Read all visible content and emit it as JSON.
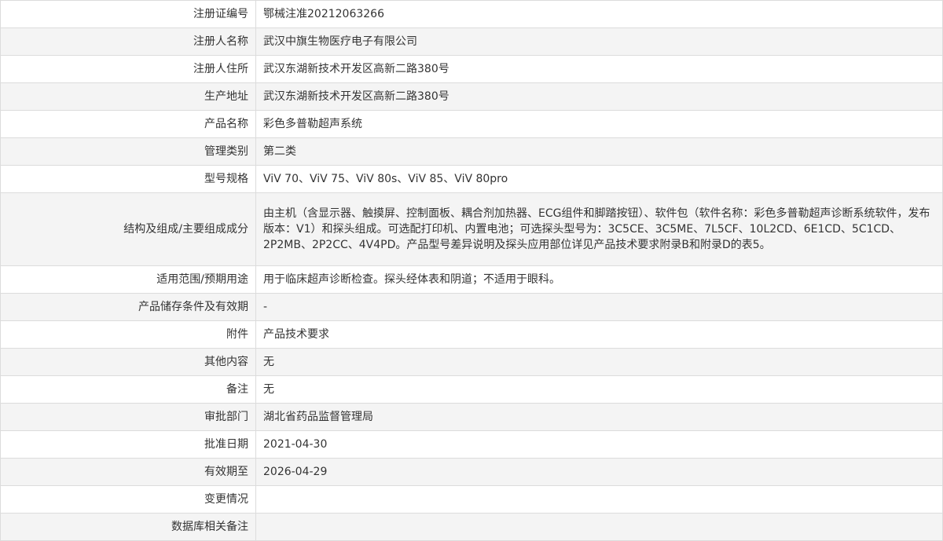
{
  "records": [
    {
      "label": "注册证编号",
      "value": "鄂械注准20212063266"
    },
    {
      "label": "注册人名称",
      "value": "武汉中旗生物医疗电子有限公司"
    },
    {
      "label": "注册人住所",
      "value": "武汉东湖新技术开发区高新二路380号"
    },
    {
      "label": "生产地址",
      "value": "武汉东湖新技术开发区高新二路380号"
    },
    {
      "label": "产品名称",
      "value": "彩色多普勒超声系统"
    },
    {
      "label": "管理类别",
      "value": "第二类"
    },
    {
      "label": "型号规格",
      "value": "ViV 70、ViV 75、ViV 80s、ViV 85、ViV 80pro"
    },
    {
      "label": "结构及组成/主要组成成分",
      "value": "由主机（含显示器、触摸屏、控制面板、耦合剂加热器、ECG组件和脚踏按钮）、软件包（软件名称：彩色多普勒超声诊断系统软件，发布版本：V1）和探头组成。可选配打印机、内置电池；可选探头型号为：3C5CE、3C5ME、7L5CF、10L2CD、6E1CD、5C1CD、2P2MB、2P2CC、4V4PD。产品型号差异说明及探头应用部位详见产品技术要求附录B和附录D的表5。"
    },
    {
      "label": "适用范围/预期用途",
      "value": "用于临床超声诊断检查。探头经体表和阴道；不适用于眼科。"
    },
    {
      "label": "产品储存条件及有效期",
      "value": "-"
    },
    {
      "label": "附件",
      "value": "产品技术要求"
    },
    {
      "label": "其他内容",
      "value": "无"
    },
    {
      "label": "备注",
      "value": "无"
    },
    {
      "label": "审批部门",
      "value": "湖北省药品监督管理局"
    },
    {
      "label": "批准日期",
      "value": "2021-04-30"
    },
    {
      "label": "有效期至",
      "value": "2026-04-29"
    },
    {
      "label": "变更情况",
      "value": ""
    },
    {
      "label": "数据库相关备注",
      "value": ""
    }
  ]
}
